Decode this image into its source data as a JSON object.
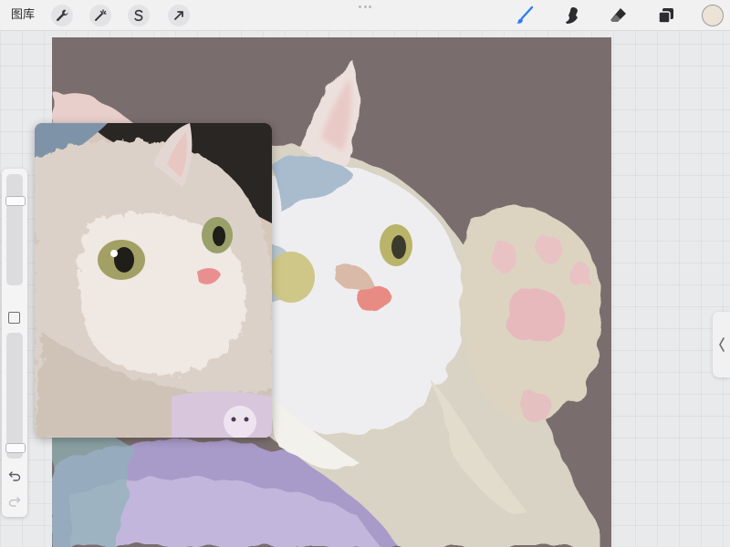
{
  "toolbar": {
    "gallery_label": "图库",
    "left_tools": [
      {
        "name": "actions",
        "icon": "wrench-icon"
      },
      {
        "name": "adjustments",
        "icon": "magic-wand-icon"
      },
      {
        "name": "selection",
        "icon": "selection-s-icon"
      },
      {
        "name": "transform",
        "icon": "arrow-cursor-icon"
      }
    ],
    "right_tools": [
      {
        "name": "brush",
        "icon": "brush-icon",
        "active": true
      },
      {
        "name": "smudge",
        "icon": "smudge-icon"
      },
      {
        "name": "eraser",
        "icon": "eraser-icon"
      },
      {
        "name": "layers",
        "icon": "layers-icon"
      }
    ],
    "current_color": "#ece3d6",
    "accent_color": "#2f7cf6"
  },
  "sidebar": {
    "brush_size_level": 0.78,
    "opacity_level": 0.05,
    "modify_icon": "square-icon",
    "undo_icon": "undo-icon",
    "redo_icon": "redo-icon"
  },
  "canvas": {
    "background_color": "#7a6d6d"
  },
  "right_handle": {
    "icon": "chevron-left-icon"
  }
}
